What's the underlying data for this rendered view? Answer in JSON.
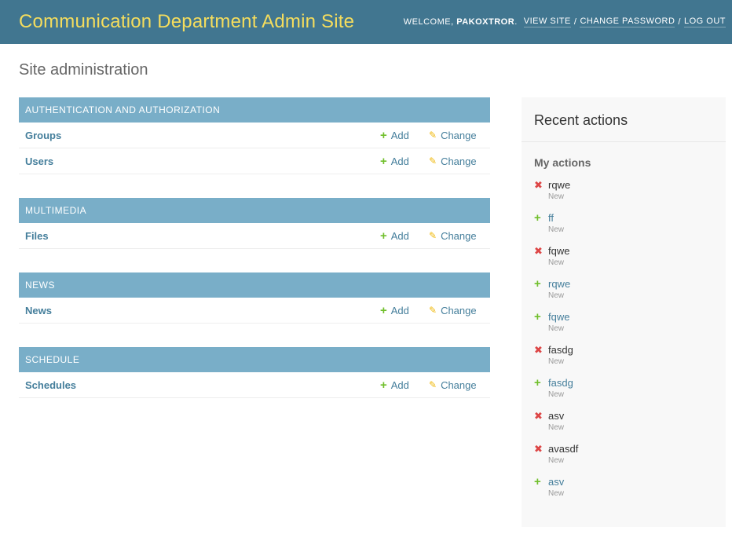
{
  "header": {
    "site_name": "Communication Department Admin Site",
    "welcome": "WELCOME,",
    "username": "PAKOXTROR",
    "view_site": "VIEW SITE",
    "change_password": "CHANGE PASSWORD",
    "log_out": "LOG OUT",
    "separator": "/"
  },
  "page_title": "Site administration",
  "labels": {
    "add": "Add",
    "change": "Change"
  },
  "modules": [
    {
      "caption": "Authentication and Authorization",
      "models": [
        "Groups",
        "Users"
      ]
    },
    {
      "caption": "Multimedia",
      "models": [
        "Files"
      ]
    },
    {
      "caption": "News",
      "models": [
        "News"
      ]
    },
    {
      "caption": "Schedule",
      "models": [
        "Schedules"
      ]
    }
  ],
  "recent_actions": {
    "title": "Recent actions",
    "subtitle": "My actions",
    "items": [
      {
        "name": "rqwe",
        "type": "New",
        "kind": "deletion"
      },
      {
        "name": "ff",
        "type": "New",
        "kind": "addition"
      },
      {
        "name": "fqwe",
        "type": "New",
        "kind": "deletion"
      },
      {
        "name": "rqwe",
        "type": "New",
        "kind": "addition"
      },
      {
        "name": "fqwe",
        "type": "New",
        "kind": "addition"
      },
      {
        "name": "fasdg",
        "type": "New",
        "kind": "deletion"
      },
      {
        "name": "fasdg",
        "type": "New",
        "kind": "addition"
      },
      {
        "name": "asv",
        "type": "New",
        "kind": "deletion"
      },
      {
        "name": "avasdf",
        "type": "New",
        "kind": "deletion"
      },
      {
        "name": "asv",
        "type": "New",
        "kind": "addition"
      }
    ]
  },
  "icons": {
    "add": "plus-icon",
    "change": "pencil-icon",
    "delete": "cross-icon"
  },
  "colors": {
    "header_bg": "#417690",
    "brand": "#f5dd5d",
    "module_caption_bg": "#79aec8",
    "link": "#447e9b",
    "add_green": "#70bf2b",
    "change_yellow": "#efb80b",
    "delete_red": "#dd4646"
  }
}
